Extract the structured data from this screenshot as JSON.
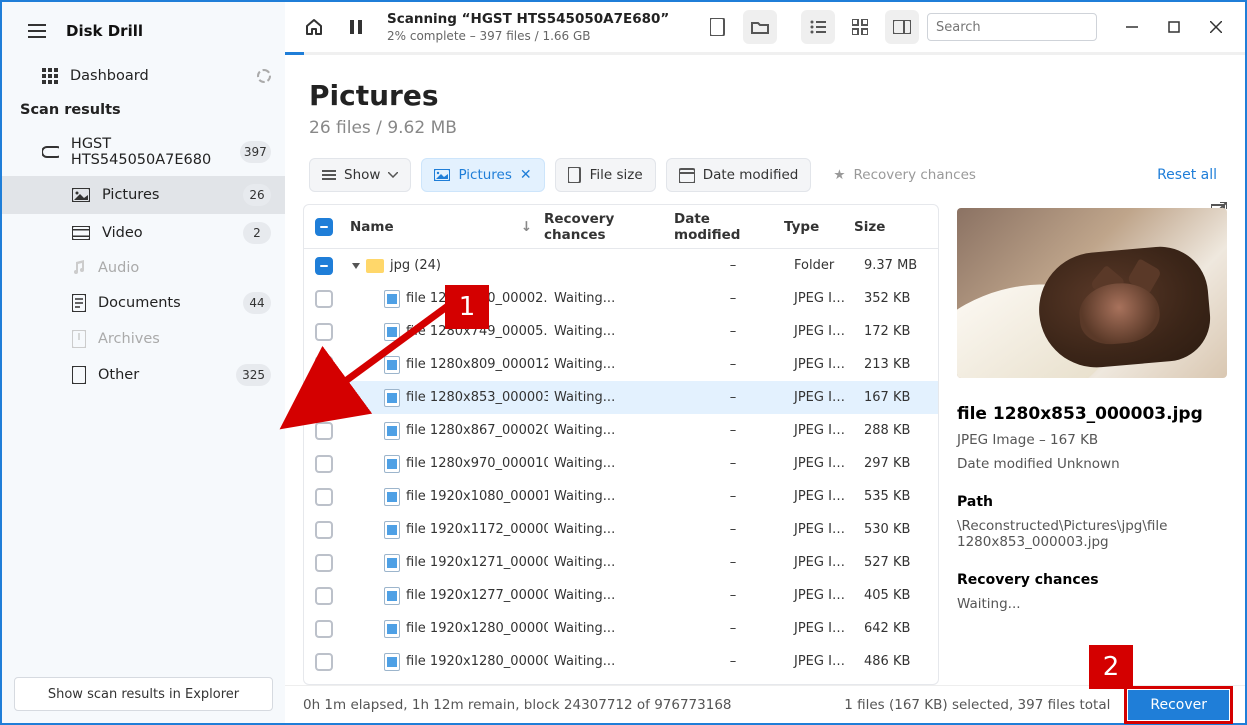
{
  "app": {
    "title": "Disk Drill"
  },
  "sidebar": {
    "dashboard": "Dashboard",
    "section": "Scan results",
    "items": [
      {
        "label": "HGST HTS545050A7E680",
        "badge": "397"
      },
      {
        "label": "Pictures",
        "badge": "26"
      },
      {
        "label": "Video",
        "badge": "2"
      },
      {
        "label": "Audio",
        "badge": ""
      },
      {
        "label": "Documents",
        "badge": "44"
      },
      {
        "label": "Archives",
        "badge": ""
      },
      {
        "label": "Other",
        "badge": "325"
      }
    ],
    "footer_btn": "Show scan results in Explorer"
  },
  "topbar": {
    "scan_title": "Scanning “HGST HTS545050A7E680”",
    "scan_sub": "2% complete – 397 files / 1.66 GB",
    "search_placeholder": "Search"
  },
  "header": {
    "title": "Pictures",
    "subtitle": "26 files / 9.62 MB"
  },
  "filterbar": {
    "show": "Show",
    "pictures": "Pictures",
    "file_size": "File size",
    "date_modified": "Date modified",
    "recovery_chances": "Recovery chances",
    "reset": "Reset all"
  },
  "table": {
    "headers": {
      "name": "Name",
      "recovery": "Recovery chances",
      "date": "Date modified",
      "type": "Type",
      "size": "Size"
    },
    "folder": {
      "name": "jpg (24)",
      "recovery": "",
      "date": "–",
      "type": "Folder",
      "size": "9.37 MB"
    },
    "rows": [
      {
        "name": "file 1280x700_00002...",
        "recovery": "Waiting...",
        "date": "–",
        "type": "JPEG Im...",
        "size": "352 KB",
        "checked": false
      },
      {
        "name": "file 1280x749_00005...",
        "recovery": "Waiting...",
        "date": "–",
        "type": "JPEG Im...",
        "size": "172 KB",
        "checked": false
      },
      {
        "name": "file 1280x809_000012...",
        "recovery": "Waiting...",
        "date": "–",
        "type": "JPEG Im...",
        "size": "213 KB",
        "checked": false
      },
      {
        "name": "file 1280x853_000003...",
        "recovery": "Waiting...",
        "date": "–",
        "type": "JPEG Im...",
        "size": "167 KB",
        "checked": true
      },
      {
        "name": "file 1280x867_000020...",
        "recovery": "Waiting...",
        "date": "–",
        "type": "JPEG Im...",
        "size": "288 KB",
        "checked": false
      },
      {
        "name": "file 1280x970_000010...",
        "recovery": "Waiting...",
        "date": "–",
        "type": "JPEG Im...",
        "size": "297 KB",
        "checked": false
      },
      {
        "name": "file 1920x1080_00001...",
        "recovery": "Waiting...",
        "date": "–",
        "type": "JPEG Im...",
        "size": "535 KB",
        "checked": false
      },
      {
        "name": "file 1920x1172_00000...",
        "recovery": "Waiting...",
        "date": "–",
        "type": "JPEG Im...",
        "size": "530 KB",
        "checked": false
      },
      {
        "name": "file 1920x1271_00000...",
        "recovery": "Waiting...",
        "date": "–",
        "type": "JPEG Im...",
        "size": "527 KB",
        "checked": false
      },
      {
        "name": "file 1920x1277_00000...",
        "recovery": "Waiting...",
        "date": "–",
        "type": "JPEG Im...",
        "size": "405 KB",
        "checked": false
      },
      {
        "name": "file 1920x1280_00000...",
        "recovery": "Waiting...",
        "date": "–",
        "type": "JPEG Im...",
        "size": "642 KB",
        "checked": false
      },
      {
        "name": "file 1920x1280_00000...",
        "recovery": "Waiting...",
        "date": "–",
        "type": "JPEG Im...",
        "size": "486 KB",
        "checked": false
      }
    ]
  },
  "preview": {
    "title": "file 1280x853_000003.jpg",
    "meta": "JPEG Image – 167 KB",
    "date": "Date modified Unknown",
    "path_label": "Path",
    "path": "\\Reconstructed\\Pictures\\jpg\\file 1280x853_000003.jpg",
    "rc_label": "Recovery chances",
    "rc_value": "Waiting..."
  },
  "status": {
    "left": "0h 1m elapsed, 1h 12m remain, block 24307712 of 976773168",
    "right": "1 files (167 KB) selected, 397 files total",
    "recover_btn": "Recover"
  },
  "callouts": {
    "step1": "1",
    "step2": "2"
  }
}
